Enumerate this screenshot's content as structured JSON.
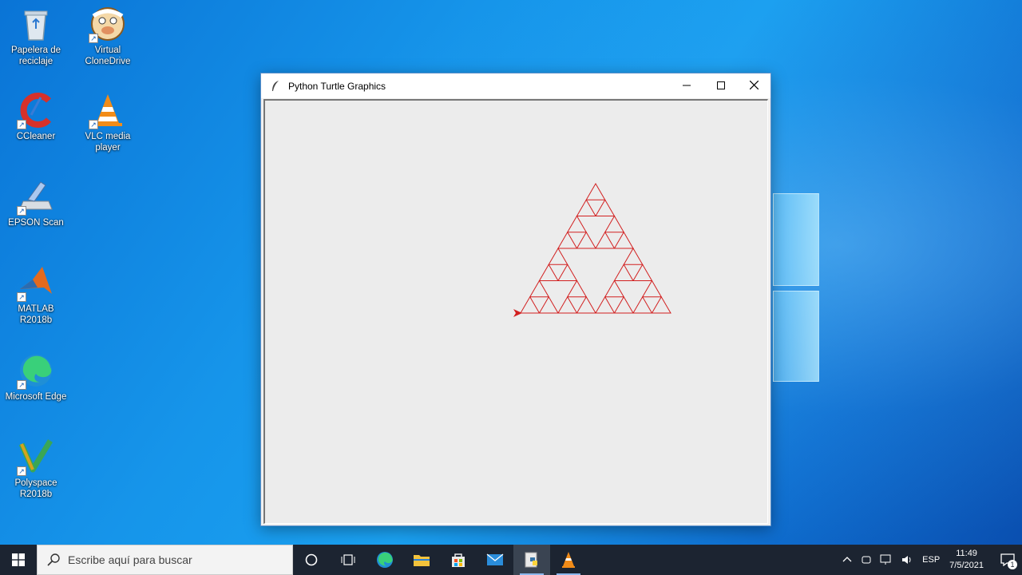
{
  "desktop": {
    "icons": [
      {
        "label": "Papelera de\nreciclaje",
        "icon": "recycle-bin-icon"
      },
      {
        "label": "Virtual\nCloneDrive",
        "icon": "virtual-clonedrive-icon"
      },
      {
        "label": "CCleaner",
        "icon": "ccleaner-icon"
      },
      {
        "label": "VLC media player",
        "icon": "vlc-icon"
      },
      {
        "label": "EPSON Scan",
        "icon": "epson-scan-icon"
      },
      {
        "label": "MATLAB R2018b",
        "icon": "matlab-icon"
      },
      {
        "label": "Microsoft Edge",
        "icon": "edge-icon"
      },
      {
        "label": "Polyspace\nR2018b",
        "icon": "polyspace-icon"
      }
    ]
  },
  "window": {
    "title": "Python Turtle Graphics",
    "icon": "feather-icon",
    "buttons": [
      "minimize-icon",
      "maximize-icon",
      "close-icon"
    ],
    "drawing": {
      "figure": "sierpinski-triangle",
      "depth": 3,
      "stroke_color": "#d22020",
      "background": "#ececec"
    }
  },
  "taskbar": {
    "search_placeholder": "Escribe aquí para buscar",
    "apps": [
      "cortana-icon",
      "task-view-icon",
      "edge-icon",
      "file-explorer-icon",
      "store-icon",
      "mail-icon",
      "python-icon",
      "vlc-icon"
    ],
    "tray": {
      "language": "ESP",
      "time": "11:49",
      "date": "7/5/2021",
      "notification_count": "1"
    }
  },
  "colors": {
    "accent": "#0a74d6",
    "taskbar": "#1c2431",
    "turtle": "#d22020"
  }
}
